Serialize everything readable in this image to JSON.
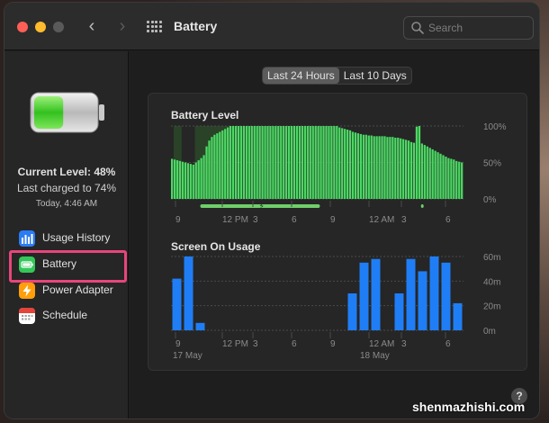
{
  "window": {
    "title": "Battery",
    "search_placeholder": "Search"
  },
  "sidebar": {
    "current_level": "Current Level: 48%",
    "last_charged": "Last charged to 74%",
    "last_charged_time": "Today, 4:46 AM",
    "battery_fill_fraction": 0.48,
    "items": [
      {
        "label": "Usage History",
        "icon": "usage-history-icon",
        "color": "#2b7cf5"
      },
      {
        "label": "Battery",
        "icon": "battery-icon",
        "color": "#34c759"
      },
      {
        "label": "Power Adapter",
        "icon": "power-adapter-icon",
        "color": "#ff9f0a"
      },
      {
        "label": "Schedule",
        "icon": "schedule-icon",
        "color": "#ffffff"
      }
    ],
    "selected": "Battery"
  },
  "range_tabs": [
    {
      "label": "Last 24 Hours",
      "active": true
    },
    {
      "label": "Last 10 Days",
      "active": false
    }
  ],
  "footer": {
    "help": "?",
    "watermark": "shenmazhishi.com"
  },
  "colors": {
    "battery_green": "#4cd964",
    "screen_blue": "#1f7ef5",
    "highlight": "#e8457b"
  },
  "chart_data": [
    {
      "type": "bar",
      "title": "Battery Level",
      "y_ticks": [
        "100%",
        "50%",
        "0%"
      ],
      "ylim": [
        0,
        100
      ],
      "x_ticks": [
        "9",
        "12 PM",
        "3",
        "6",
        "9",
        "12 AM",
        "3",
        "6"
      ],
      "values": [
        55,
        54,
        53,
        52,
        51,
        50,
        49,
        48,
        47,
        50,
        53,
        56,
        60,
        72,
        80,
        85,
        88,
        90,
        92,
        94,
        96,
        98,
        100,
        100,
        100,
        100,
        100,
        100,
        100,
        100,
        100,
        100,
        100,
        100,
        100,
        100,
        100,
        100,
        100,
        100,
        100,
        100,
        100,
        100,
        100,
        100,
        100,
        100,
        100,
        100,
        100,
        100,
        100,
        100,
        100,
        100,
        100,
        100,
        100,
        100,
        100,
        100,
        100,
        98,
        97,
        96,
        95,
        94,
        92,
        91,
        90,
        89,
        88,
        88,
        87,
        87,
        86,
        86,
        86,
        86,
        86,
        85,
        85,
        85,
        84,
        84,
        83,
        82,
        81,
        80,
        78,
        77,
        99,
        100,
        76,
        74,
        72,
        70,
        68,
        66,
        64,
        62,
        60,
        58,
        56,
        55,
        54,
        52,
        51,
        50
      ],
      "charging_ranges": [
        [
          1,
          4
        ],
        [
          9,
          22
        ],
        [
          92,
          94
        ]
      ],
      "charging_indicator_bands": [
        [
          11,
          56
        ],
        [
          94,
          95
        ]
      ]
    },
    {
      "type": "bar",
      "title": "Screen On Usage",
      "y_ticks": [
        "60m",
        "40m",
        "20m",
        "0m"
      ],
      "ylim": [
        0,
        60
      ],
      "x_ticks": [
        "9",
        "12 PM",
        "3",
        "6",
        "9",
        "12 AM",
        "3",
        "6"
      ],
      "date_labels": [
        {
          "label": "17 May",
          "slot": 0
        },
        {
          "label": "18 May",
          "slot": 16
        }
      ],
      "values": [
        42,
        60,
        6,
        0,
        0,
        0,
        0,
        0,
        0,
        0,
        0,
        0,
        0,
        0,
        0,
        30,
        55,
        58,
        0,
        30,
        58,
        48,
        60,
        55,
        22
      ]
    }
  ]
}
